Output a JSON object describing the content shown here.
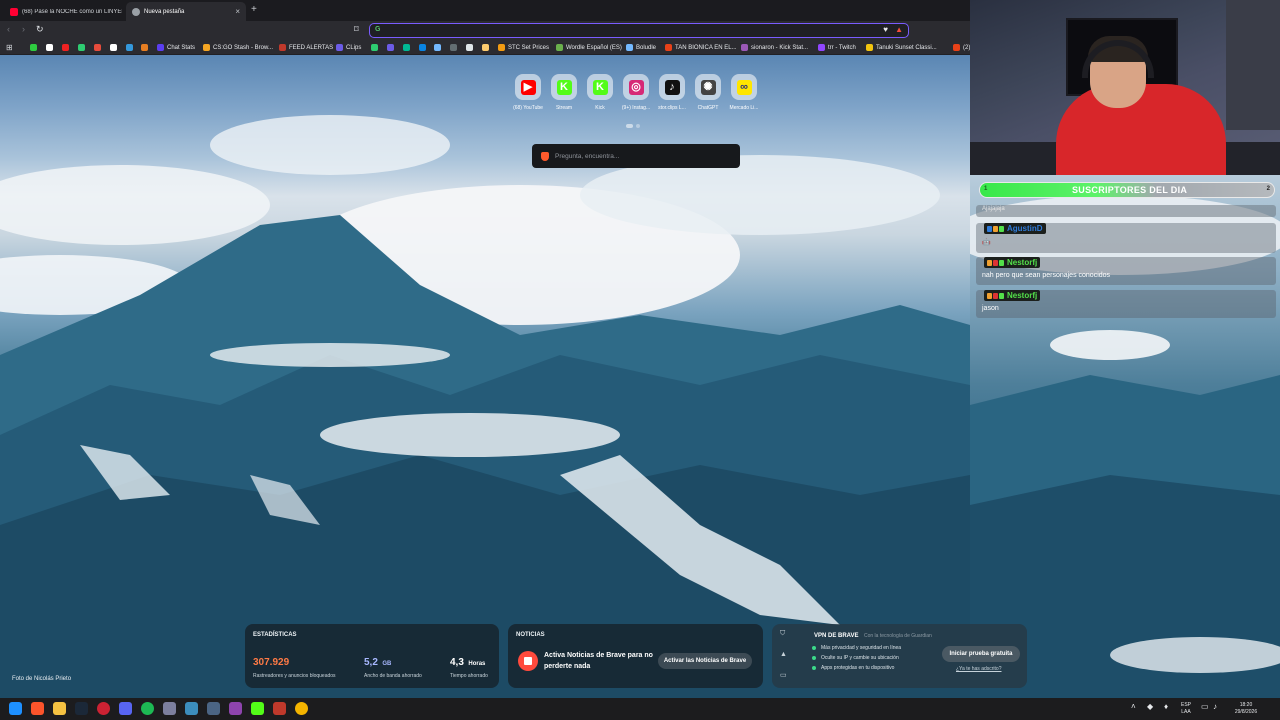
{
  "browser": {
    "tabs": [
      {
        "label": "(68) Pasé la NOCHE como un LINYER...",
        "active": false
      },
      {
        "label": "Nueva pestaña",
        "active": true
      }
    ],
    "new_tab_glyph": "+",
    "tab_close_glyph": "×",
    "omnibox_value": "",
    "bookmarks": [
      {
        "label": "",
        "color": "#2ecc40"
      },
      {
        "label": "",
        "color": "#ffffff"
      },
      {
        "label": "",
        "color": "#e22"
      },
      {
        "label": "",
        "color": "#2ecc71"
      },
      {
        "label": "",
        "color": "#e74c3c"
      },
      {
        "label": "",
        "color": "#ffffff"
      },
      {
        "label": "",
        "color": "#3498db"
      },
      {
        "label": "",
        "color": "#e67e22"
      },
      {
        "label": "Chat Stats",
        "color": "#5b3ef0"
      },
      {
        "label": "CS:GO Stash - Brow...",
        "color": "#f5a623"
      },
      {
        "label": "FEED ALERTAS",
        "color": "#c0392b"
      },
      {
        "label": "CLips",
        "color": "#6c5ce7"
      },
      {
        "label": "",
        "color": "#2ecc71"
      },
      {
        "label": "",
        "color": "#6c5ce7"
      },
      {
        "label": "",
        "color": "#00b894"
      },
      {
        "label": "",
        "color": "#0984e3"
      },
      {
        "label": "",
        "color": "#74b9ff"
      },
      {
        "label": "",
        "color": "#636e72"
      },
      {
        "label": "",
        "color": "#dfe6e9"
      },
      {
        "label": "",
        "color": "#fdcb6e"
      },
      {
        "label": "STC Set Prices",
        "color": "#f39c12"
      },
      {
        "label": "Wordle Español (ES)",
        "color": "#6ab04c"
      },
      {
        "label": "Boludle",
        "color": "#74b9ff"
      },
      {
        "label": "TAN BIONICA EN EL...",
        "color": "#e84118"
      },
      {
        "label": "sionaron - Kick Stat...",
        "color": "#9b59b6"
      },
      {
        "label": "trr - Twitch",
        "color": "#9146ff"
      },
      {
        "label": "Tanuki Sunset Classi...",
        "color": "#f1c40f"
      },
      {
        "label": "(2)",
        "color": "#e84118"
      }
    ]
  },
  "newtab": {
    "tiles": [
      {
        "label": "(68) YouTube",
        "glyph": "▶",
        "color": "#ff0000"
      },
      {
        "label": "Stream",
        "glyph": "K",
        "color": "#53fc18"
      },
      {
        "label": "Kick",
        "glyph": "K",
        "color": "#53fc18"
      },
      {
        "label": "(9+) Instag...",
        "glyph": "◎",
        "color": "#d62976"
      },
      {
        "label": "stor.clips L...",
        "glyph": "♪",
        "color": "#111111"
      },
      {
        "label": "ChatGPT",
        "glyph": "✺",
        "color": "#444444"
      },
      {
        "label": "Mercado Li...",
        "glyph": "∞",
        "color": "#ffe600"
      }
    ],
    "search_placeholder": "Pregunta, encuentra...",
    "photo_credit": "Foto de Nicolás Prieto",
    "stats": {
      "title": "ESTADÍSTICAS",
      "blocked_value": "307.929",
      "blocked_desc": "Rastreadores y anuncios bloqueados",
      "bandwidth_value": "5,2",
      "bandwidth_unit": "GB",
      "bandwidth_desc": "Ancho de banda ahorrado",
      "time_value": "4,3",
      "time_unit": "Horas",
      "time_desc": "Tiempo ahorrado"
    },
    "news": {
      "title": "NOTICIAS",
      "text": "Activa Noticias de Brave para no perderte nada",
      "button": "Activar las Noticias de Brave"
    },
    "vpn": {
      "title": "VPN DE BRAVE",
      "subtitle": "Con la tecnología de Guardian",
      "items": [
        "Más privacidad y seguridad en línea",
        "Oculte su IP y cambie su ubicación",
        "Apps protegidas en tu dispositivo"
      ],
      "button": "Iniciar prueba gratuita",
      "link": "¿Ya te has adscrito?"
    },
    "accent": "#7a5cff"
  },
  "overlay": {
    "subs_bar": {
      "left": "1",
      "title": "SUSCRIPTORES DEL DIA",
      "right": "2"
    },
    "chat": [
      {
        "user": "",
        "color": "",
        "msg": "Ajajajaja"
      },
      {
        "user": "AgustinD",
        "color": "#2f7bd8",
        "msg": "🤖"
      },
      {
        "user": "Nestorfj",
        "color": "#53e04a",
        "msg": "nah pero que sean personajes conocidos"
      },
      {
        "user": "Nestorfj",
        "color": "#53e04a",
        "msg": "jason"
      }
    ]
  },
  "taskbar": {
    "lang_top": "ESP",
    "lang_bottom": "LAA",
    "time": "18:20",
    "date": "29/8/2026"
  }
}
